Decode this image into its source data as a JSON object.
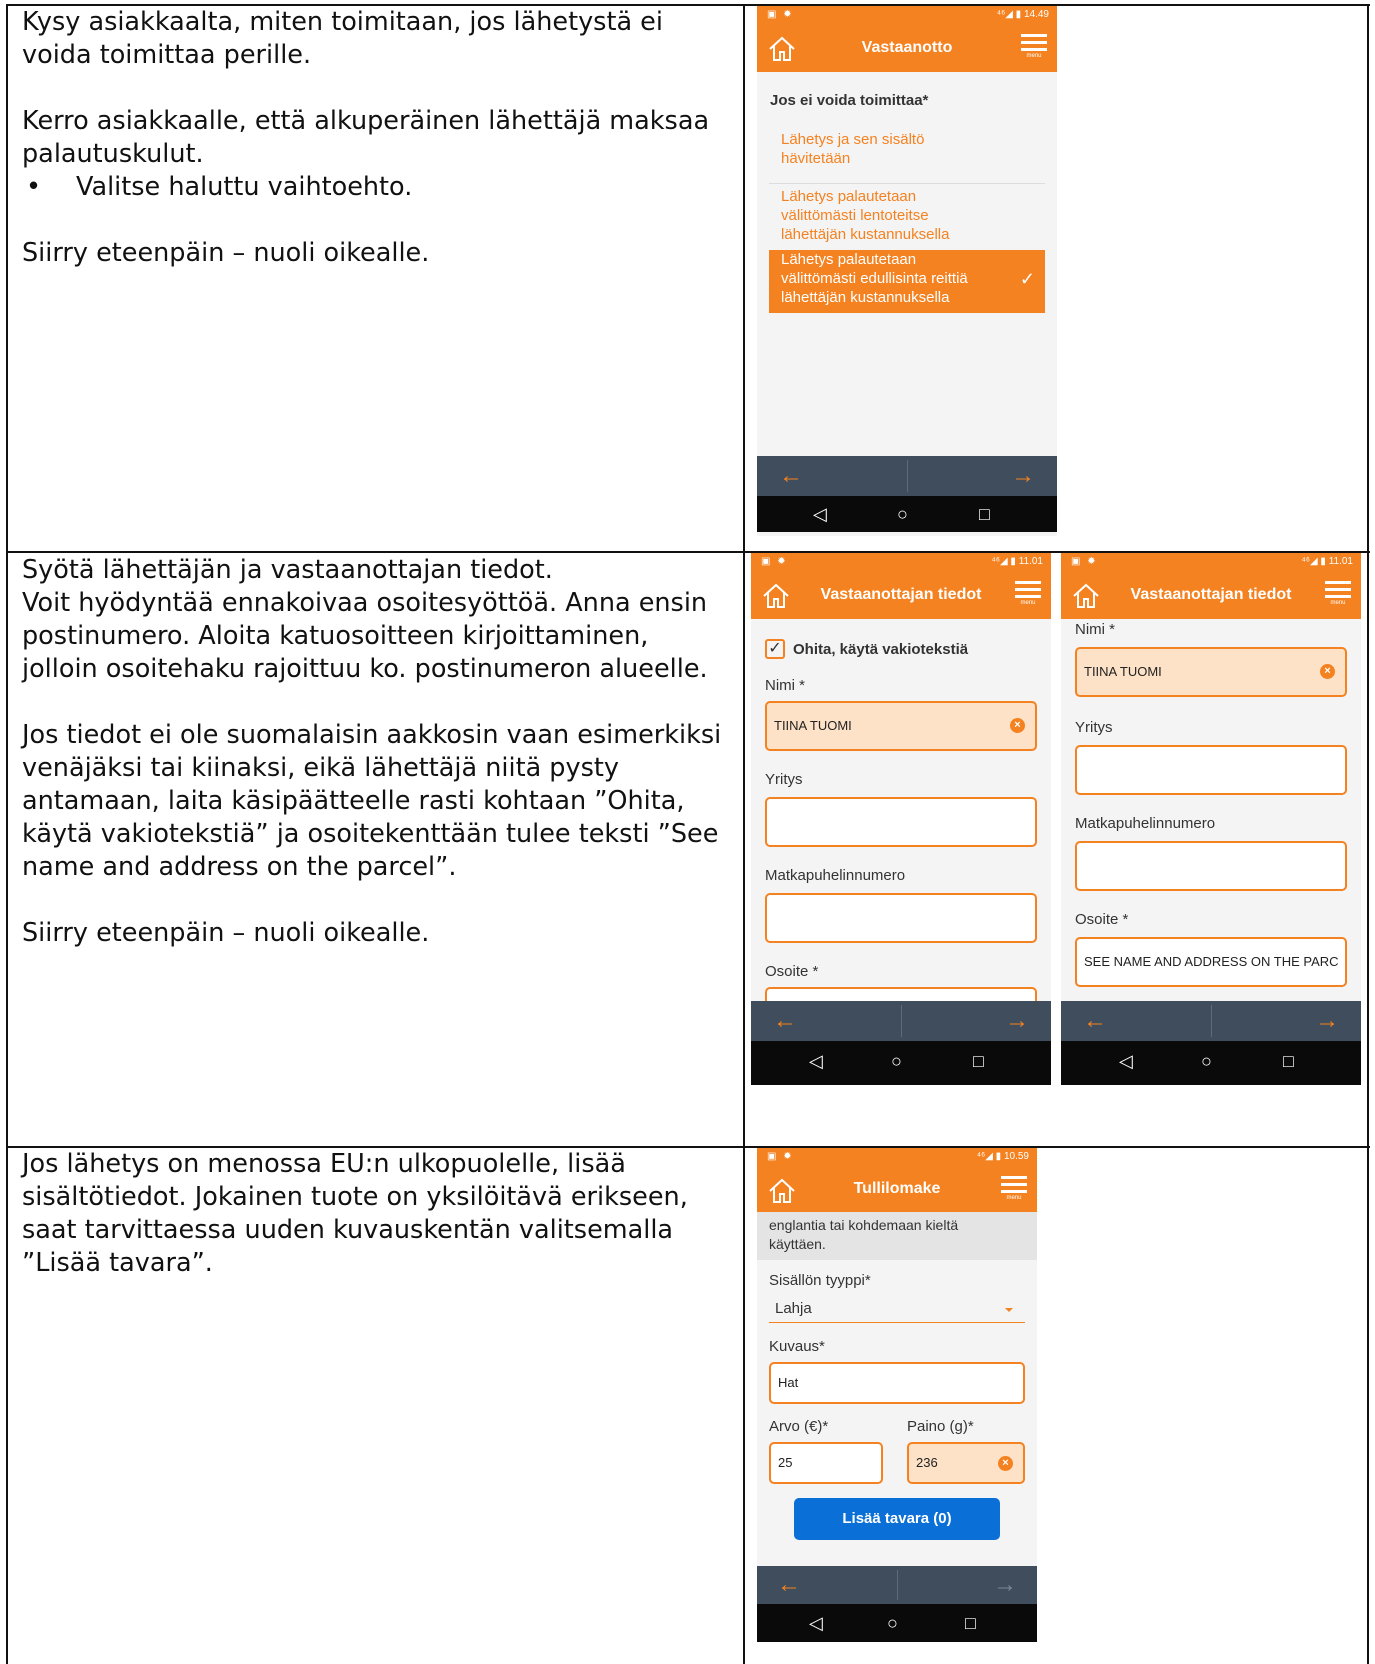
{
  "rows": [
    {
      "text": {
        "p1": "Kysy asiakkaalta, miten toimitaan, jos lähetystä ei voida toimittaa perille.",
        "p2": "Kerro asiakkaalle, että alkuperäinen lähettäjä maksaa palautuskulut.",
        "bullet": "Valitse haluttu vaihtoehto.",
        "p3": "Siirry eteenpäin – nuoli oikealle."
      },
      "phone": {
        "status_time": "14.49",
        "title": "Vastaanotto",
        "menu_label": "menu",
        "question": "Jos ei voida toimittaa*",
        "options": [
          {
            "line1": "Lähetys ja sen sisältö",
            "line2": "hävitetään",
            "line3": ""
          },
          {
            "line1": "Lähetys palautetaan",
            "line2": "välittömästi lentoteitse",
            "line3": "lähettäjän kustannuksella"
          },
          {
            "line1": "Lähetys palautetaan",
            "line2": "välittömästi edullisinta reittiä",
            "line3": "lähettäjän kustannuksella"
          }
        ],
        "selected_option": 3
      }
    },
    {
      "text": {
        "l1": "Syötä lähettäjän ja vastaanottajan tiedot.",
        "l2": "Voit hyödyntää ennakoivaa osoitesyöttöä. Anna ensin postinumero. Aloita katuosoitteen kirjoittaminen, jolloin osoitehaku rajoittuu ko. postinumeron alueelle.",
        "p2": "Jos tiedot ei ole suomalaisin aakkosin vaan esimerkiksi venäjäksi tai kiinaksi, eikä lähettäjä niitä pysty antamaan, laita käsipäätteelle rasti kohtaan ”Ohita, käytä vakiotekstiä” ja osoitekenttään tulee teksti ”See name and address on the parcel”.",
        "p3": "Siirry eteenpäin – nuoli oikealle."
      },
      "phone_a": {
        "status_time": "11.01",
        "title": "Vastaanottajan tiedot",
        "menu_label": "menu",
        "checkbox_label": "Ohita, käytä vakiotekstiä",
        "checkbox_checked": true,
        "name_label": "Nimi *",
        "name_value": "TIINA TUOMI",
        "company_label": "Yritys",
        "phone_label": "Matkapuhelinnumero",
        "address_label": "Osoite *"
      },
      "phone_b": {
        "status_time": "11.01",
        "title": "Vastaanottajan tiedot",
        "menu_label": "menu",
        "name_label": "Nimi *",
        "name_value": "TIINA TUOMI",
        "company_label": "Yritys",
        "phone_label": "Matkapuhelinnumero",
        "address_label": "Osoite *",
        "address_value": "SEE NAME AND ADDRESS ON THE PARC"
      }
    },
    {
      "text": {
        "p1": "Jos lähetys on menossa EU:n ulkopuolelle, lisää sisältötiedot. Jokainen tuote on yksilöitävä erikseen, saat tarvittaessa uuden kuvauskentän valitsemalla ”Lisää tavara”."
      },
      "phone": {
        "status_time": "10.59",
        "title": "Tullilomake",
        "menu_label": "menu",
        "info_line1": "englantia tai kohdemaan kieltä",
        "info_line2": "käyttäen.",
        "type_label": "Sisällön tyyppi*",
        "type_value": "Lahja",
        "desc_label": "Kuvaus*",
        "desc_value": "Hat",
        "value_label": "Arvo (€)*",
        "value_value": "25",
        "weight_label": "Paino (g)*",
        "weight_value": "236",
        "add_button": "Lisää tavara (0)"
      }
    }
  ],
  "nav": {
    "back": "←",
    "forward": "→"
  },
  "sys": {
    "back": "◁",
    "home": "○",
    "recent": "□"
  },
  "status_icons": "▣ ✹",
  "signal_icons": "⁴⁶◢ ▮",
  "clear_glyph": "×",
  "check_glyph": "✓",
  "colors": {
    "accent": "#f58220",
    "navbar": "#3f4d5c",
    "button": "#0a6fd6"
  }
}
